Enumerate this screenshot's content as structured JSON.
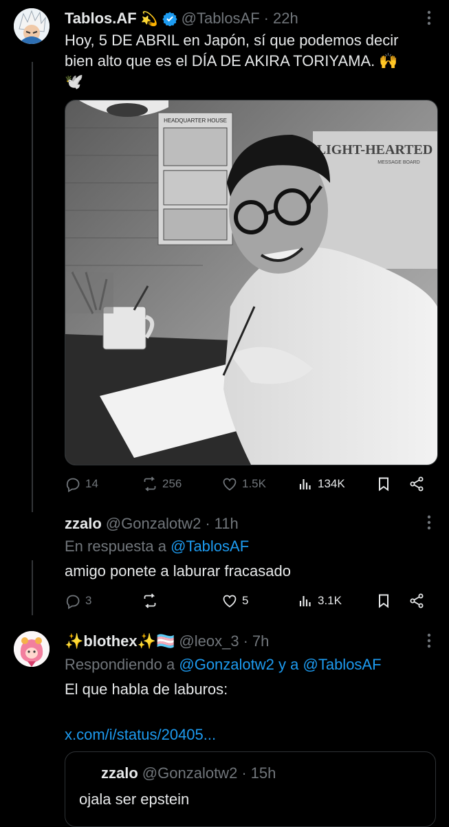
{
  "tweet1": {
    "name": "Tablos.AF",
    "emoji": "💫",
    "handle": "@TablosAF",
    "sep": "·",
    "time": "22h",
    "text_line1": "Hoy, 5 DE ABRIL en Japón, sí que podemos decir",
    "text_line2": "bien alto que es el DÍA DE AKIRA TORIYAMA. 🙌",
    "text_line3": "🕊️",
    "photo": {
      "board_title": "HEADQUARTER HOUSE",
      "sign_text": "LIGHT-HEARTED",
      "sign_sub": "MESSAGE BOARD"
    },
    "stats": {
      "replies": "14",
      "reposts": "256",
      "likes": "1.5K",
      "views": "134K"
    }
  },
  "reply1": {
    "name": "zzalo",
    "handle": "@Gonzalotw2",
    "sep": "·",
    "time": "11h",
    "reply_prefix": "En respuesta a",
    "reply_to": "@TablosAF",
    "text": "amigo ponete a laburar fracasado",
    "stats": {
      "replies": "3",
      "reposts": "",
      "likes": "5",
      "views": "3.1K"
    }
  },
  "reply2": {
    "name": "✨blothex✨🏳️‍⚧️",
    "handle": "@leox_3",
    "sep": "·",
    "time": "7h",
    "reply_prefix": "Respondiendo a",
    "reply_to_1": "@Gonzalotw2",
    "reply_and": "y a",
    "reply_to_2": "@TablosAF",
    "text": "El que habla de laburos:",
    "link": "x.com/i/status/20405...",
    "quote": {
      "name": "zzalo",
      "handle": "@Gonzalotw2",
      "sep": "·",
      "time": "15h",
      "text": "ojala ser epstein"
    }
  },
  "icons": {
    "more": "more-horizontal-icon",
    "verified": "verified-badge-icon",
    "reply": "reply-icon",
    "repost": "repost-icon",
    "like": "like-icon",
    "views": "views-icon",
    "bookmark": "bookmark-icon",
    "share": "share-icon"
  },
  "colors": {
    "background": "#000000",
    "text": "#e7e9ea",
    "muted": "#71767b",
    "link": "#1d9bf0",
    "verified": "#1d9bf0"
  }
}
